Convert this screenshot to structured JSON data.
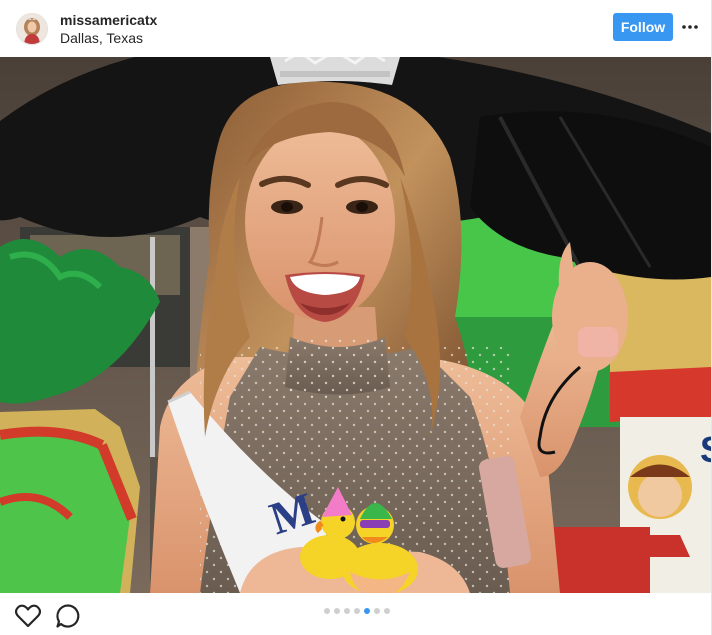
{
  "post": {
    "username": "missamericatx",
    "location": "Dallas, Texas",
    "follow_label": "Follow",
    "more_icon": "more-horizontal-icon",
    "avatar_icon": "profile-avatar"
  },
  "photo": {
    "sash_text": "M",
    "sign_text": "S"
  },
  "footer": {
    "like_icon": "heart-icon",
    "comment_icon": "comment-icon",
    "carousel": {
      "total": 7,
      "active_index": 4
    }
  },
  "colors": {
    "follow_bg": "#3897f0",
    "active_dot": "#3897f0",
    "inactive_dot": "#cfcfcf"
  }
}
